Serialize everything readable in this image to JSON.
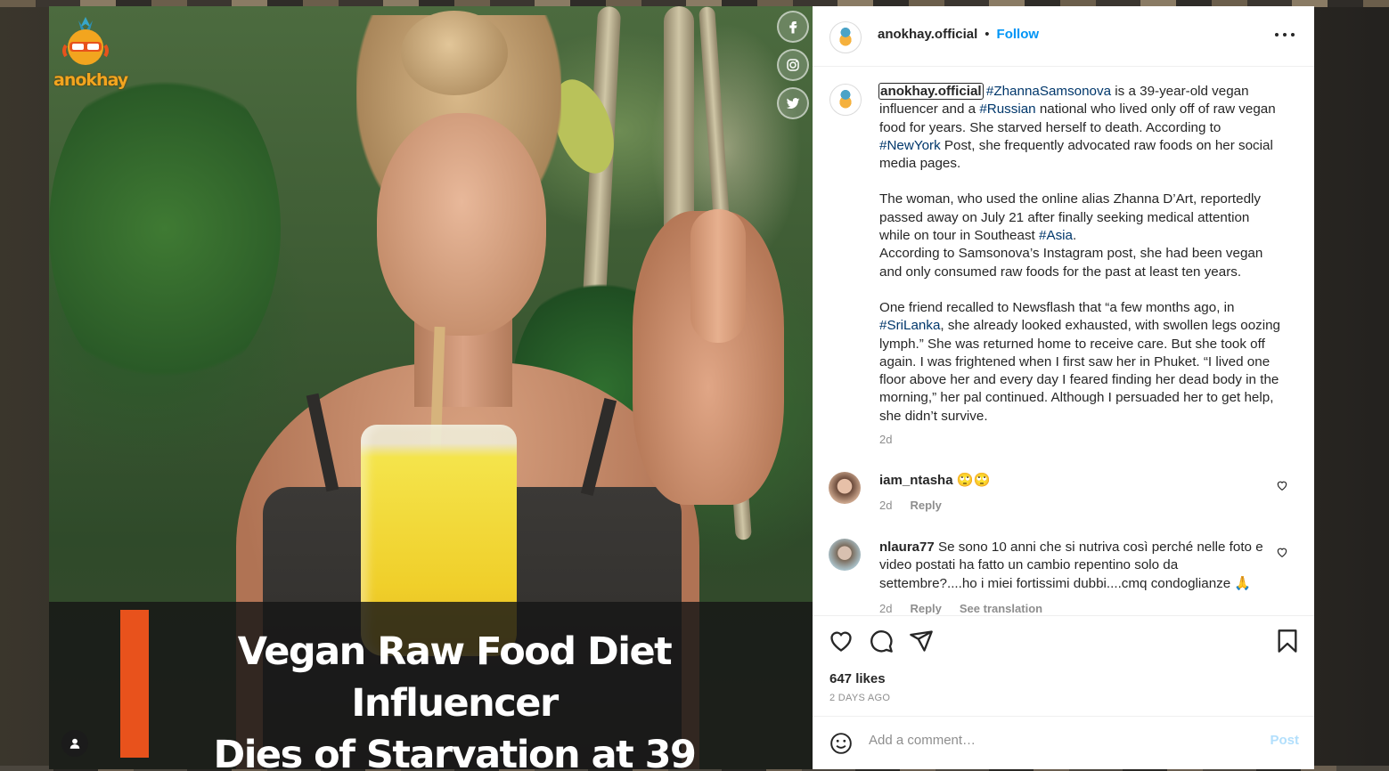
{
  "brand": {
    "logo_text": "anokhay"
  },
  "media": {
    "headline_line1": "Vegan Raw Food Diet Influencer",
    "headline_line2": "Dies of Starvation at 39",
    "share_icons": [
      "facebook-icon",
      "instagram-icon",
      "twitter-icon"
    ],
    "accent_color": "#e8521c"
  },
  "header": {
    "username": "anokhay.official",
    "separator": "•",
    "follow_label": "Follow"
  },
  "caption": {
    "username": "anokhay.official",
    "p1_tag1": "#ZhannaSamsonova",
    "p1_t1": " is a 39-year-old vegan influencer and a ",
    "p1_tag2": "#Russian",
    "p1_t2": " national who lived only off of raw vegan food for years. She starved herself to death. According to ",
    "p1_tag3": "#NewYork",
    "p1_t3": " Post, she frequently advocated raw foods on her social media pages.",
    "p2_t1": "The woman, who used the online alias Zhanna D’Art, reportedly passed away on July 21 after finally seeking medical attention while on tour in Southeast ",
    "p2_tag1": "#Asia",
    "p2_t2": ".",
    "p3": "According to Samsonova’s Instagram post, she had been vegan and only consumed raw foods for the past at least ten years.",
    "p4_t1": "One friend recalled to Newsflash that “a few months ago, in ",
    "p4_tag1": "#SriLanka",
    "p4_t2": ", she already looked exhausted, with swollen legs oozing lymph.” She was returned home to receive care. But she took off again. I was frightened when I first saw her in Phuket. “I lived one floor above her and every day I feared finding her dead body in the morning,” her pal continued. Although I persuaded her to get help, she didn’t survive.",
    "time": "2d"
  },
  "comments": [
    {
      "username": "iam_ntasha",
      "text": "🙄🙄",
      "time": "2d",
      "reply": "Reply",
      "extra": ""
    },
    {
      "username": "nlaura77",
      "text": "Se sono 10 anni che si nutriva così perché nelle foto e video postati ha fatto un cambio repentino solo da settembre?....ho i miei fortissimi dubbi....cmq condoglianze 🙏",
      "time": "2d",
      "reply": "Reply",
      "extra": "See translation"
    }
  ],
  "actions": {
    "likes": "647 likes",
    "posted": "2 DAYS AGO",
    "icons": [
      "heart-icon",
      "comment-icon",
      "share-icon",
      "bookmark-icon"
    ]
  },
  "add_comment": {
    "placeholder": "Add a comment…",
    "post_label": "Post"
  }
}
